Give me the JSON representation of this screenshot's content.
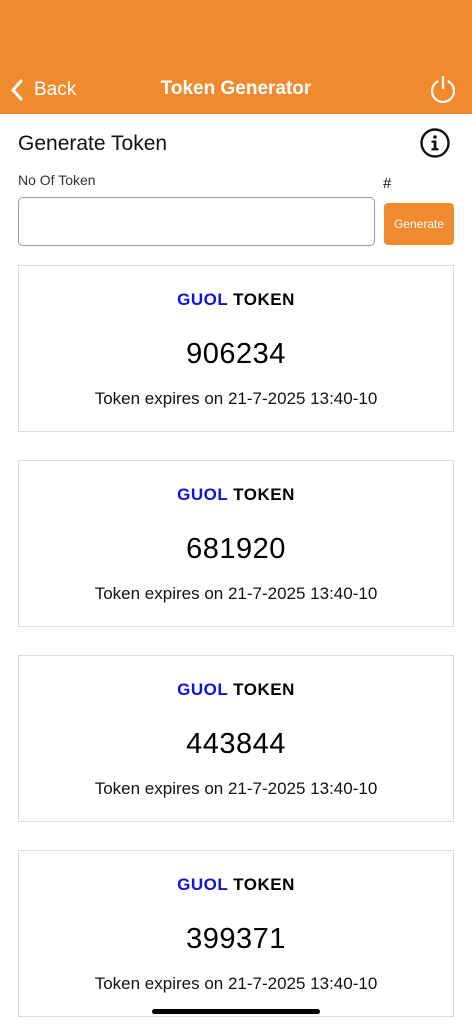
{
  "nav": {
    "back_label": "Back",
    "title": "Token Generator",
    "back_icon": "chevron-left-icon",
    "power_icon": "power-icon"
  },
  "form": {
    "section_title": "Generate Token",
    "info_icon": "info-icon",
    "field_label": "No Of Token",
    "hash_label": "#",
    "input_value": "",
    "input_placeholder": "",
    "generate_label": "Generate"
  },
  "tokens": [
    {
      "brand_a": "GUOL",
      "brand_b": "TOKEN",
      "number": "906234",
      "expiry": "Token expires on 21-7-2025 13:40-10"
    },
    {
      "brand_a": "GUOL",
      "brand_b": "TOKEN",
      "number": "681920",
      "expiry": "Token expires on 21-7-2025 13:40-10"
    },
    {
      "brand_a": "GUOL",
      "brand_b": "TOKEN",
      "number": "443844",
      "expiry": "Token expires on 21-7-2025 13:40-10"
    },
    {
      "brand_a": "GUOL",
      "brand_b": "TOKEN",
      "number": "399371",
      "expiry": "Token expires on 21-7-2025 13:40-10"
    }
  ],
  "colors": {
    "accent": "#EF8A2F",
    "brand_blue": "#1014d8",
    "brand_black": "#000000"
  }
}
